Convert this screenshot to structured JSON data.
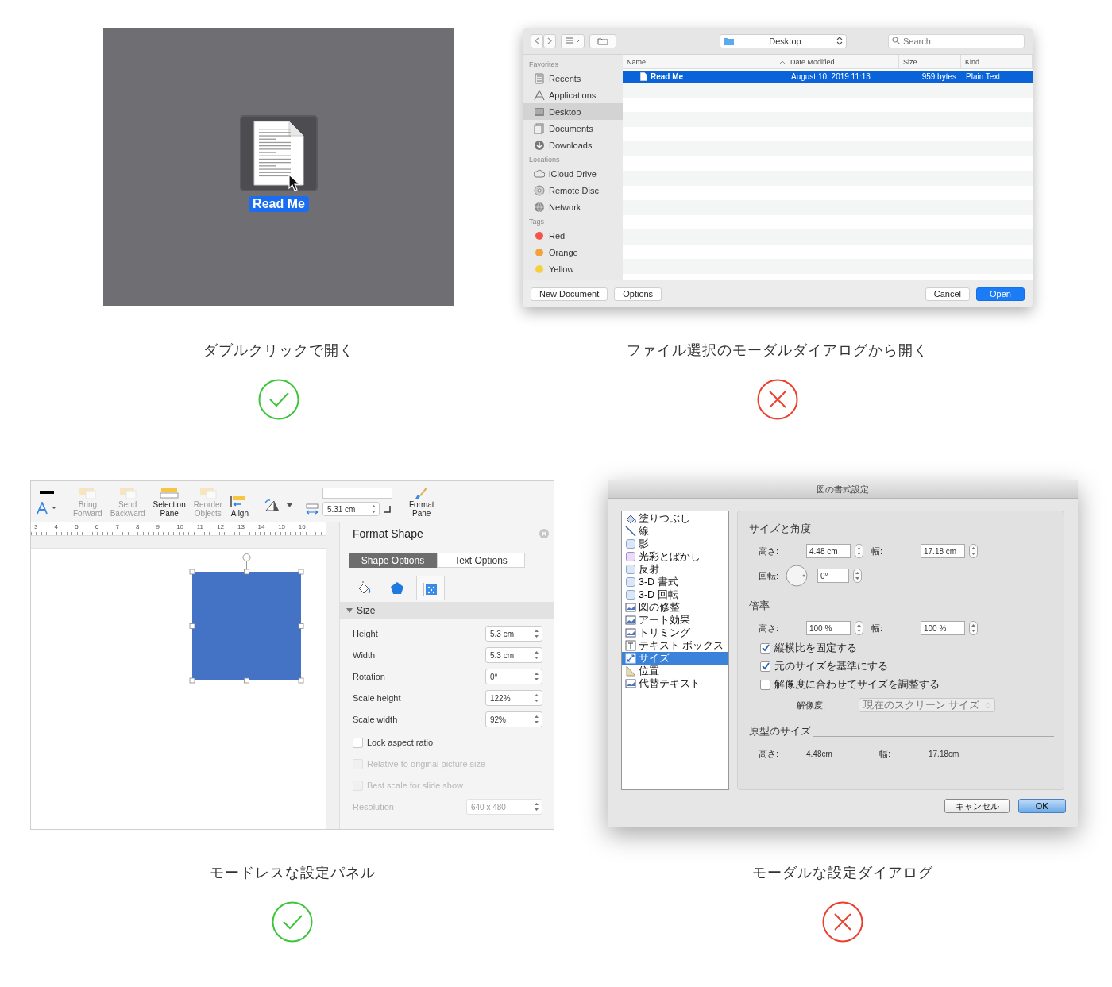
{
  "figures": [
    {
      "kind": "desktop",
      "file": {
        "label": "Read Me",
        "selected": true
      },
      "caption": "ダブルクリックで開く",
      "approved": true
    },
    {
      "kind": "open_dialog",
      "location": "Desktop",
      "search": {
        "placeholder": "Search"
      },
      "sidebar": [
        {
          "heading": "Favorites",
          "items": [
            {
              "label": "Recents",
              "kind": "recents",
              "selected": false
            },
            {
              "label": "Applications",
              "kind": "applications",
              "selected": false
            },
            {
              "label": "Desktop",
              "kind": "desktop",
              "selected": true
            },
            {
              "label": "Documents",
              "kind": "documents",
              "selected": false
            },
            {
              "label": "Downloads",
              "kind": "downloads",
              "selected": false
            }
          ]
        },
        {
          "heading": "Locations",
          "items": [
            {
              "label": "iCloud Drive",
              "kind": "cloud",
              "selected": false
            },
            {
              "label": "Remote Disc",
              "kind": "disc",
              "selected": false
            },
            {
              "label": "Network",
              "kind": "network",
              "selected": false
            }
          ]
        },
        {
          "heading": "Tags",
          "items": [
            {
              "label": "Red",
              "kind": "tag",
              "color": "#f4554a",
              "selected": false
            },
            {
              "label": "Orange",
              "kind": "tag",
              "color": "#f5a13a",
              "selected": false
            },
            {
              "label": "Yellow",
              "kind": "tag",
              "color": "#f6cf3e",
              "selected": false
            }
          ]
        }
      ],
      "columns": [
        {
          "label": "Name",
          "sorted": true
        },
        {
          "label": "Date Modified",
          "sorted": false
        },
        {
          "label": "Size",
          "sorted": false
        },
        {
          "label": "Kind",
          "sorted": false
        }
      ],
      "rows": [
        {
          "cells": [
            "Read Me",
            "August 10, 2019 11:13",
            "959 bytes",
            "Plain Text"
          ],
          "selected": true
        }
      ],
      "buttons": [
        {
          "label": "New Document",
          "default": false
        },
        {
          "label": "Options",
          "default": false
        },
        {
          "label": "Cancel",
          "default": false
        },
        {
          "label": "Open",
          "default": true
        }
      ],
      "caption": "ファイル選択のモーダルダイアログから開く",
      "approved": false
    },
    {
      "kind": "format_pane",
      "ribbon": [
        {
          "kind": "font_color"
        },
        {
          "kind": "arrange",
          "label": "Bring Forward",
          "disabled": true
        },
        {
          "kind": "arrange",
          "label": "Send Backward",
          "disabled": true
        },
        {
          "kind": "pane",
          "label": "Selection Pane",
          "disabled": false
        },
        {
          "kind": "arrange",
          "label": "Reorder Objects",
          "disabled": true
        },
        {
          "kind": "align",
          "label": "Align",
          "disabled": false
        },
        {
          "kind": "rotate"
        },
        {
          "kind": "size",
          "value": "5.31 cm"
        },
        {
          "kind": "format",
          "label": "Format Pane",
          "disabled": false
        }
      ],
      "ruler": [
        "3",
        "4",
        "5",
        "6",
        "7",
        "8",
        "9",
        "10",
        "11",
        "12",
        "13",
        "14",
        "15",
        "16"
      ],
      "pane": {
        "title": "Format Shape",
        "tabs": [
          {
            "label": "Shape Options",
            "selected": true
          },
          {
            "label": "Text Options",
            "selected": false
          }
        ],
        "icon_tabs": [
          {
            "kind": "fill",
            "selected": false
          },
          {
            "kind": "effects",
            "selected": false
          },
          {
            "kind": "size",
            "selected": true
          }
        ],
        "section": {
          "label": "Size",
          "expanded": true
        },
        "fields": [
          {
            "label": "Height",
            "value": "5.3 cm"
          },
          {
            "label": "Width",
            "value": "5.3 cm"
          },
          {
            "label": "Rotation",
            "value": "0°"
          },
          {
            "label": "Scale height",
            "value": "122%"
          },
          {
            "label": "Scale width",
            "value": "92%"
          }
        ],
        "checks": [
          {
            "label": "Lock aspect ratio",
            "checked": false,
            "disabled": false
          },
          {
            "label": "Relative to original picture size",
            "checked": false,
            "disabled": true
          },
          {
            "label": "Best scale for slide show",
            "checked": false,
            "disabled": true
          }
        ],
        "resolution": {
          "label": "Resolution",
          "value": "640 x 480",
          "disabled": true
        }
      },
      "caption": "モードレスな設定パネル",
      "approved": true
    },
    {
      "kind": "format_dialog",
      "title": "図の書式設定",
      "categories": [
        {
          "label": "塗りつぶし",
          "kind": "fill",
          "selected": false
        },
        {
          "label": "線",
          "kind": "line",
          "selected": false
        },
        {
          "label": "影",
          "kind": "box",
          "selected": false
        },
        {
          "label": "光彩とぼかし",
          "kind": "glow",
          "selected": false
        },
        {
          "label": "反射",
          "kind": "box",
          "selected": false
        },
        {
          "label": "3-D 書式",
          "kind": "box",
          "selected": false
        },
        {
          "label": "3-D 回転",
          "kind": "box",
          "selected": false
        },
        {
          "label": "図の修整",
          "kind": "picture",
          "selected": false
        },
        {
          "label": "アート効果",
          "kind": "picture",
          "selected": false
        },
        {
          "label": "トリミング",
          "kind": "picture",
          "selected": false
        },
        {
          "label": "テキスト ボックス",
          "kind": "text",
          "selected": false
        },
        {
          "label": "サイズ",
          "kind": "size",
          "selected": true
        },
        {
          "label": "位置",
          "kind": "ruler",
          "selected": false
        },
        {
          "label": "代替テキスト",
          "kind": "picture",
          "selected": false
        }
      ],
      "sections": [
        {
          "heading": "サイズと角度",
          "items": [
            {
              "kind": "pair",
              "fields": [
                {
                  "label": "高さ:",
                  "value": "4.48 cm"
                },
                {
                  "label": "幅:",
                  "value": "17.18 cm"
                }
              ]
            },
            {
              "kind": "dial",
              "label": "回転:",
              "value": "0°"
            }
          ]
        },
        {
          "heading": "倍率",
          "items": [
            {
              "kind": "pair",
              "fields": [
                {
                  "label": "高さ:",
                  "value": "100 %"
                },
                {
                  "label": "幅:",
                  "value": "100 %"
                }
              ]
            },
            {
              "kind": "check",
              "label": "縦横比を固定する",
              "checked": true
            },
            {
              "kind": "check",
              "label": "元のサイズを基準にする",
              "checked": true
            },
            {
              "kind": "check",
              "label": "解像度に合わせてサイズを調整する",
              "checked": false
            },
            {
              "kind": "select",
              "label": "解像度:",
              "value": "現在のスクリーン サイズ",
              "disabled": true
            }
          ]
        },
        {
          "heading": "原型のサイズ",
          "items": [
            {
              "kind": "static_pair",
              "fields": [
                {
                  "label": "高さ:",
                  "value": "4.48cm"
                },
                {
                  "label": "幅:",
                  "value": "17.18cm"
                }
              ]
            }
          ]
        }
      ],
      "buttons": [
        {
          "label": "キャンセル",
          "default": false
        },
        {
          "label": "OK",
          "default": true
        }
      ],
      "caption": "モーダルな設定ダイアログ",
      "approved": false
    }
  ]
}
